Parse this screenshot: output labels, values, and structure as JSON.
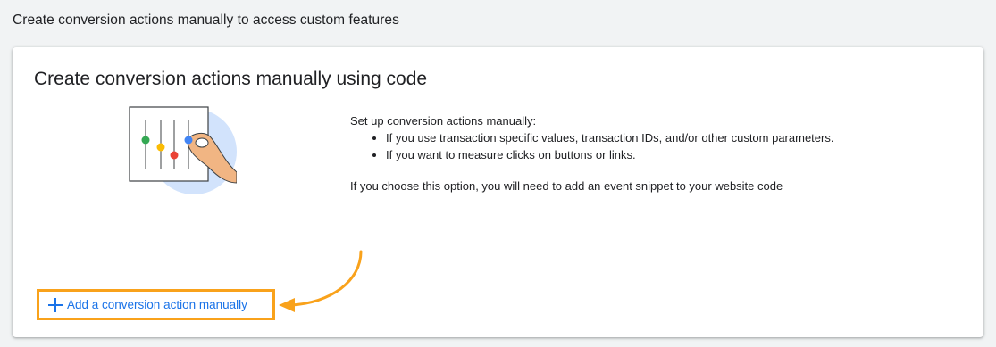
{
  "page": {
    "heading": "Create conversion actions manually to access custom features"
  },
  "card": {
    "title": "Create conversion actions manually using code",
    "description": {
      "intro": "Set up conversion actions manually:",
      "bullets": [
        "If you use transaction specific values, transaction IDs, and/or other custom parameters.",
        "If you want to measure clicks on buttons or links."
      ],
      "note": "If you choose this option, you will need to add an event snippet to your website code"
    },
    "action": {
      "label": "Add a conversion action manually",
      "icon": "plus-icon"
    },
    "illustration": {
      "icon": "sliders-hand-illustration"
    }
  },
  "colors": {
    "accent": "#1a73e8",
    "highlight": "#f9a21b",
    "background": "#f1f3f4",
    "illustration_circle": "#d2e3fc",
    "dot_green": "#34a853",
    "dot_yellow": "#fbbc04",
    "dot_red": "#ea4335",
    "dot_blue": "#4285f4",
    "skin": "#f1b583"
  }
}
